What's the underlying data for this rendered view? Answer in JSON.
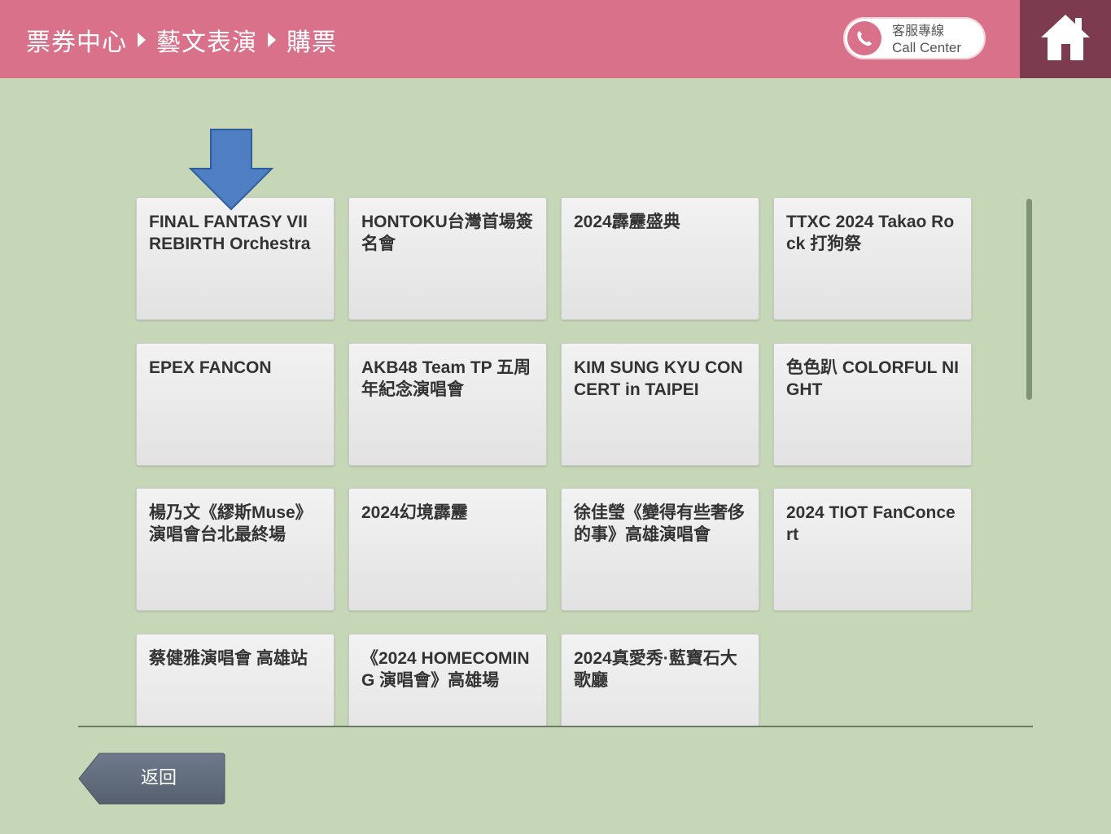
{
  "header": {
    "breadcrumb": [
      "票券中心",
      "藝文表演",
      "購票"
    ],
    "call_center": {
      "line1": "客服專線",
      "line2": "Call Center"
    },
    "home_icon": "home-icon",
    "phone_icon": "phone-icon"
  },
  "events": [
    "FINAL FANTASY VII REBIRTH Orchestra",
    "HONTOKU台灣首場簽名會",
    "2024霹靂盛典",
    "TTXC 2024 Takao Rock 打狗祭",
    "EPEX FANCON",
    "AKB48 Team TP 五周年紀念演唱會",
    "KIM SUNG KYU CONCERT in TAIPEI",
    "色色趴 COLORFUL NIGHT",
    "楊乃文《繆斯Muse》演唱會台北最終場",
    "2024幻境霹靂",
    "徐佳瑩《變得有些奢侈的事》高雄演唱會",
    "2024 TIOT FanConcert",
    "蔡健雅演唱會 高雄站",
    "《2024 HOMECOMING 演唱會》高雄場",
    "2024真愛秀·藍寶石大歌廳"
  ],
  "footer": {
    "back_label": "返回"
  },
  "colors": {
    "header": "#d9718a",
    "home": "#7d3b4f",
    "background": "#c5d7b6",
    "back_button": "#5c6778",
    "arrow": "#4f7fc2"
  }
}
